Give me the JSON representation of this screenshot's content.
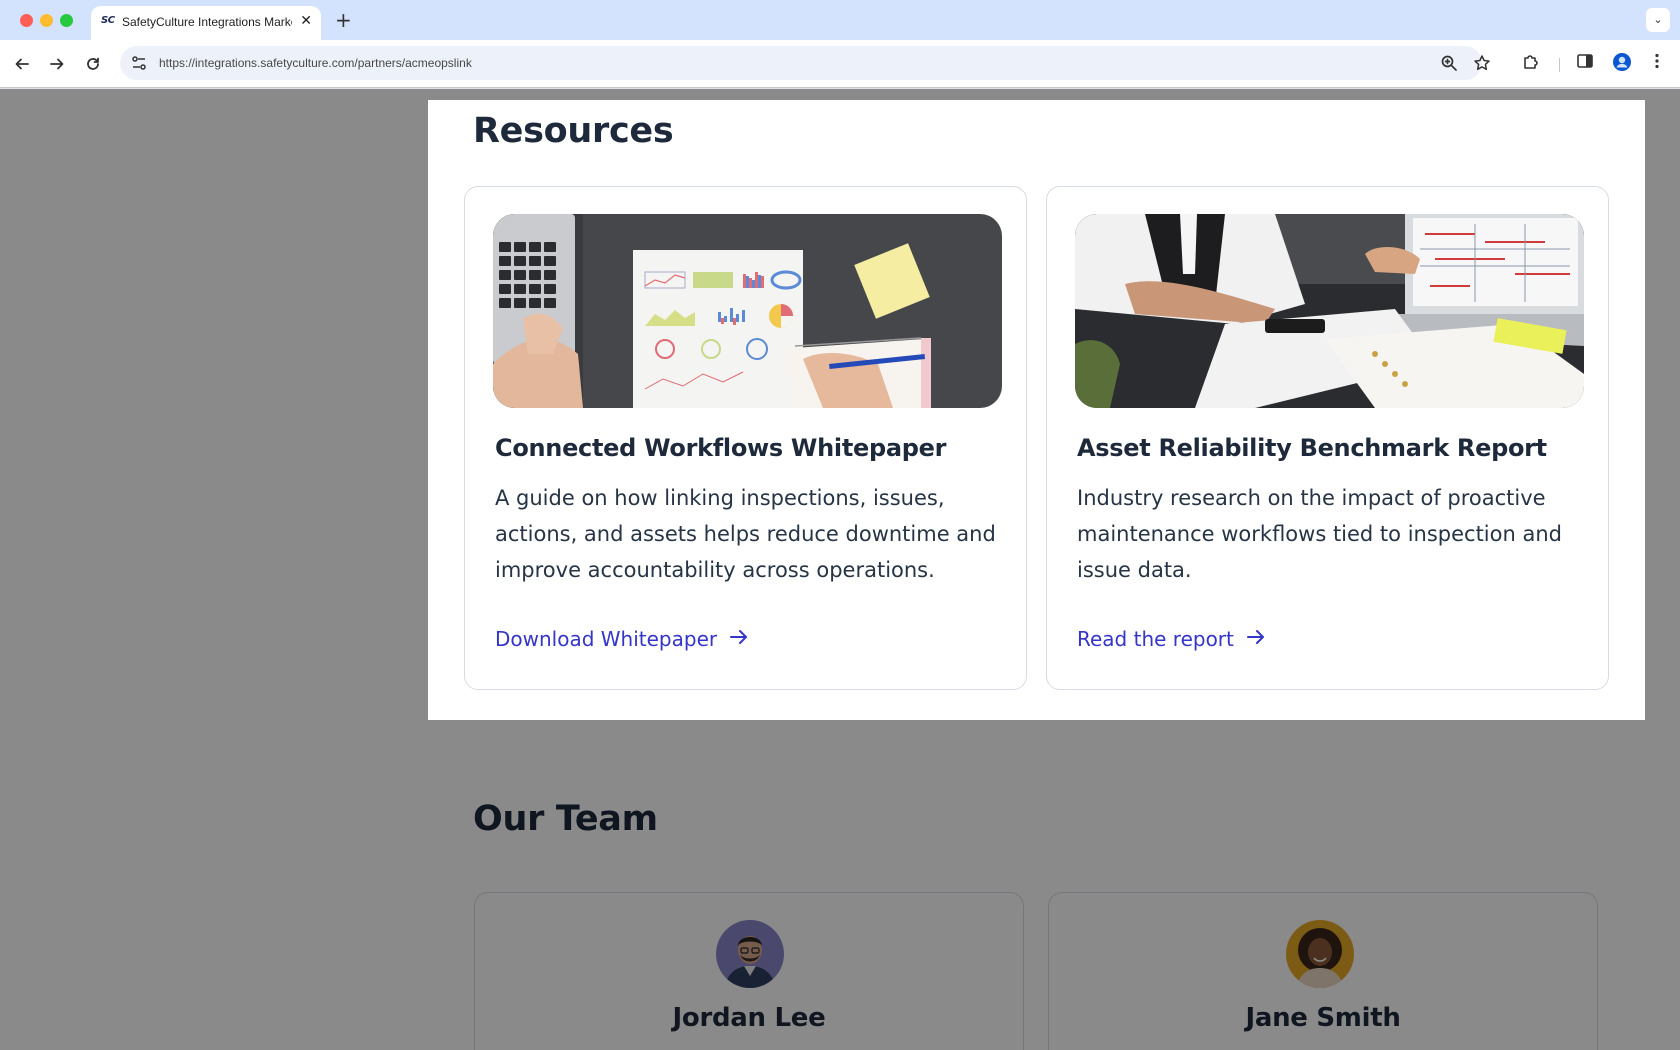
{
  "browser": {
    "tab": {
      "favicon_text": "SC",
      "title": "SafetyCulture Integrations Market…"
    },
    "url": "https://integrations.safetyculture.com/partners/acmeopslink",
    "icons": {
      "back": "back-arrow-icon",
      "forward": "forward-arrow-icon",
      "reload": "reload-icon",
      "site_info": "site-settings-icon",
      "zoom": "zoom-icon",
      "bookmark": "star-icon",
      "extensions": "puzzle-icon",
      "side_panel": "side-panel-icon",
      "profile": "profile-icon",
      "menu": "kebab-menu-icon"
    }
  },
  "resources": {
    "title": "Resources",
    "cards": [
      {
        "title": "Connected Workflows Whitepaper",
        "description": "A guide on how linking inspections, issues, actions, and assets helps reduce downtime and improve accountability across operations.",
        "link_label": "Download Whitepaper",
        "link_icon": "arrow-right-icon"
      },
      {
        "title": "Asset Reliability Benchmark Report",
        "description": "Industry research on the impact of proactive maintenance workflows tied to inspection and issue data.",
        "link_label": "Read the report",
        "link_icon": "arrow-right-icon"
      }
    ]
  },
  "team": {
    "title": "Our Team",
    "members": [
      {
        "name": "Jordan Lee"
      },
      {
        "name": "Jane Smith"
      }
    ]
  },
  "colors": {
    "heading": "#1e2a3b",
    "link": "#3535c9",
    "overlay": "rgba(0,0,0,0.46)"
  }
}
